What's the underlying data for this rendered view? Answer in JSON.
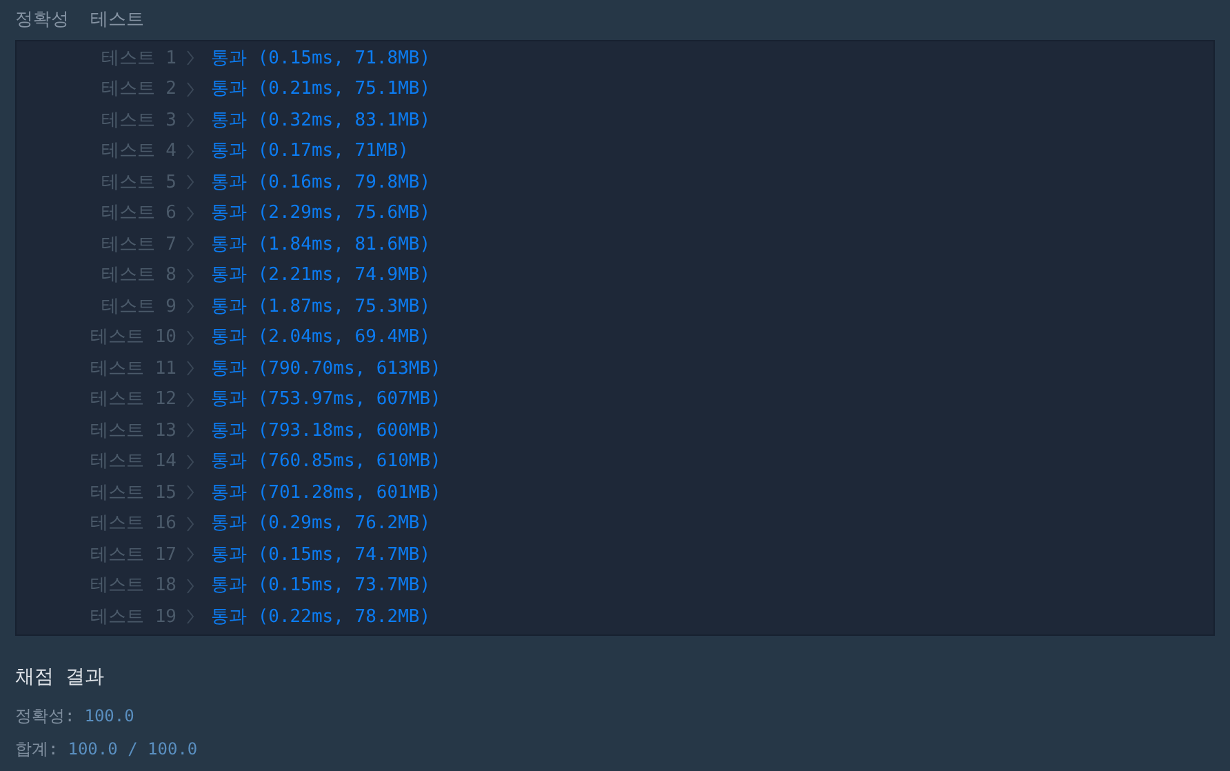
{
  "header": "정확성  테스트",
  "tests": [
    {
      "label": "테스트 1",
      "result": "통과 (0.15ms, 71.8MB)"
    },
    {
      "label": "테스트 2",
      "result": "통과 (0.21ms, 75.1MB)"
    },
    {
      "label": "테스트 3",
      "result": "통과 (0.32ms, 83.1MB)"
    },
    {
      "label": "테스트 4",
      "result": "통과 (0.17ms, 71MB)"
    },
    {
      "label": "테스트 5",
      "result": "통과 (0.16ms, 79.8MB)"
    },
    {
      "label": "테스트 6",
      "result": "통과 (2.29ms, 75.6MB)"
    },
    {
      "label": "테스트 7",
      "result": "통과 (1.84ms, 81.6MB)"
    },
    {
      "label": "테스트 8",
      "result": "통과 (2.21ms, 74.9MB)"
    },
    {
      "label": "테스트 9",
      "result": "통과 (1.87ms, 75.3MB)"
    },
    {
      "label": "테스트 10",
      "result": "통과 (2.04ms, 69.4MB)"
    },
    {
      "label": "테스트 11",
      "result": "통과 (790.70ms, 613MB)"
    },
    {
      "label": "테스트 12",
      "result": "통과 (753.97ms, 607MB)"
    },
    {
      "label": "테스트 13",
      "result": "통과 (793.18ms, 600MB)"
    },
    {
      "label": "테스트 14",
      "result": "통과 (760.85ms, 610MB)"
    },
    {
      "label": "테스트 15",
      "result": "통과 (701.28ms, 601MB)"
    },
    {
      "label": "테스트 16",
      "result": "통과 (0.29ms, 76.2MB)"
    },
    {
      "label": "테스트 17",
      "result": "통과 (0.15ms, 74.7MB)"
    },
    {
      "label": "테스트 18",
      "result": "통과 (0.15ms, 73.7MB)"
    },
    {
      "label": "테스트 19",
      "result": "통과 (0.22ms, 78.2MB)"
    }
  ],
  "summary": {
    "title": "채점 결과",
    "lines": [
      {
        "label": "정확성:",
        "value": "100.0"
      },
      {
        "label": "합계:",
        "value": "100.0 / 100.0"
      }
    ]
  }
}
